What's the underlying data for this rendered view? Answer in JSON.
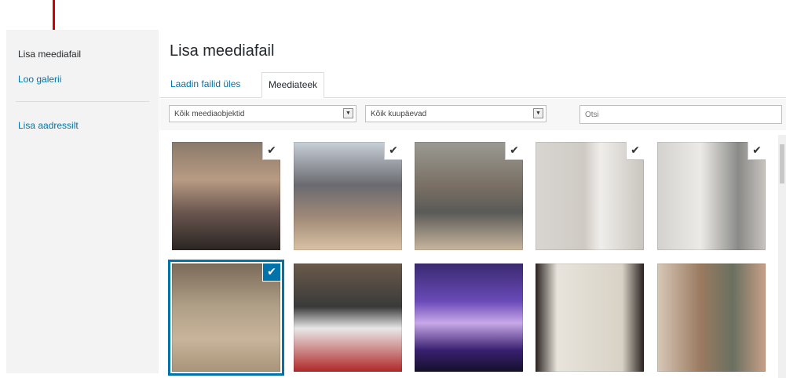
{
  "sidebar": {
    "items": [
      {
        "label": "Lisa meediafail"
      },
      {
        "label": "Loo galerii"
      },
      {
        "label": "Lisa aadressilt"
      }
    ]
  },
  "main": {
    "title": "Lisa meediafail",
    "tabs": [
      {
        "label": "Laadin failid üles"
      },
      {
        "label": "Meediateek"
      }
    ],
    "filters": {
      "type_select": "Kõik meediaobjektid",
      "date_select": "Kõik kuupäevad",
      "search_placeholder": "Otsi"
    }
  },
  "thumbnails": [
    {
      "desc": "children-room-photo",
      "checked": true,
      "selected": false
    },
    {
      "desc": "children-floor-photo",
      "checked": true,
      "selected": false
    },
    {
      "desc": "children-hall-photo",
      "checked": true,
      "selected": false
    },
    {
      "desc": "boy-poster-photo",
      "checked": true,
      "selected": false
    },
    {
      "desc": "boys-poster-photo",
      "checked": true,
      "selected": false
    },
    {
      "desc": "room-circle-photo",
      "checked": true,
      "selected": true
    },
    {
      "desc": "group-table-photo",
      "checked": false,
      "selected": false
    },
    {
      "desc": "stage-dance-photo",
      "checked": false,
      "selected": false
    },
    {
      "desc": "document-photo",
      "checked": false,
      "selected": false
    },
    {
      "desc": "climbing-photo",
      "checked": false,
      "selected": false
    }
  ],
  "colors": {
    "accent": "#0073aa",
    "annotation": "#d40000"
  },
  "icons": {
    "check": "checkmark-icon",
    "dropdown": "chevron-down-icon"
  }
}
